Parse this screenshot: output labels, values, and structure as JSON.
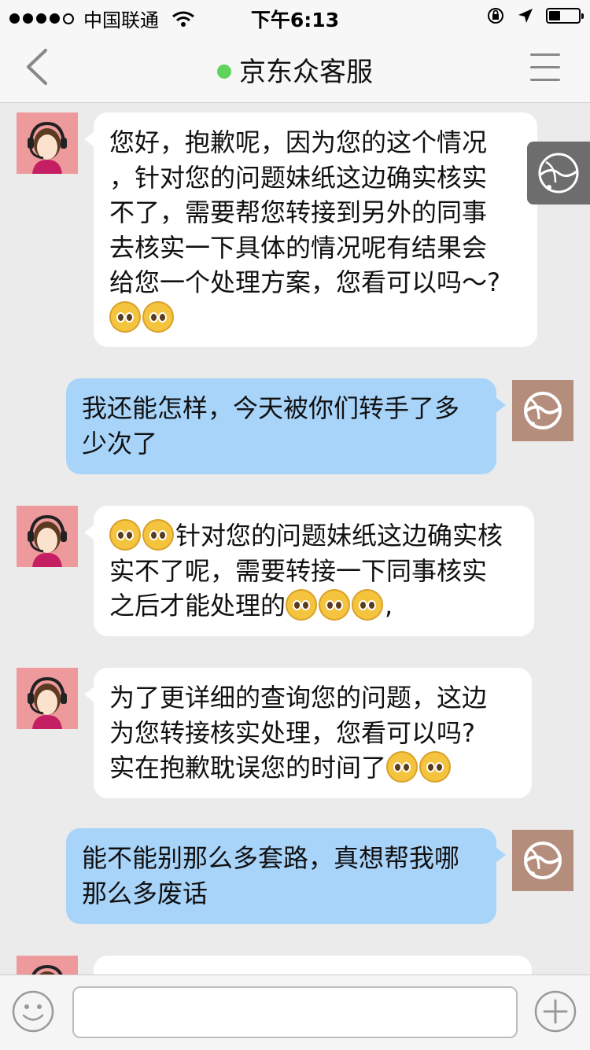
{
  "status_bar": {
    "carrier": "中国联通",
    "time": "下午6:13",
    "signal_dots": 4,
    "battery_level": 0.4
  },
  "navbar": {
    "title": "京东众客服",
    "online_color": "#5fd35b",
    "back_icon": "chevron-left-icon",
    "menu_icon": "hamburger-menu-icon"
  },
  "messages": [
    {
      "sender": "agent",
      "lines": [
        "您好，抱歉呢，因为您的这个情况",
        "，针对您的问题妹纸这边确实核实",
        "不了，需要帮您转接到另外的同事",
        "去核实一下具体的情况呢有结果会",
        "给您一个处理方案，您看可以吗～?"
      ],
      "emoji_line": 2
    },
    {
      "sender": "user",
      "lines": [
        "我还能怎样，今天被你们转手了多",
        "少次了"
      ]
    },
    {
      "sender": "agent",
      "line1": "针对您的问题妹纸这边确实核",
      "line2": "实不了呢，需要转接一下同事核实",
      "line3": "之后才能处理的",
      "line3_tail": ","
    },
    {
      "sender": "agent",
      "lines": [
        " 为了更详细的查询您的问题，这边",
        "为您转接核实处理，您看可以吗?",
        "实在抱歉耽误您的时间了"
      ]
    },
    {
      "sender": "user",
      "lines": [
        "能不能别那么多套路，真想帮我哪",
        "那么多废话"
      ]
    }
  ],
  "input": {
    "value": "",
    "emoji_button_icon": "smiley-icon",
    "plus_button_icon": "plus-circle-icon"
  },
  "colors": {
    "agent_bubble": "#ffffff",
    "user_bubble": "#a9d4fa",
    "background": "#ebebeb"
  }
}
